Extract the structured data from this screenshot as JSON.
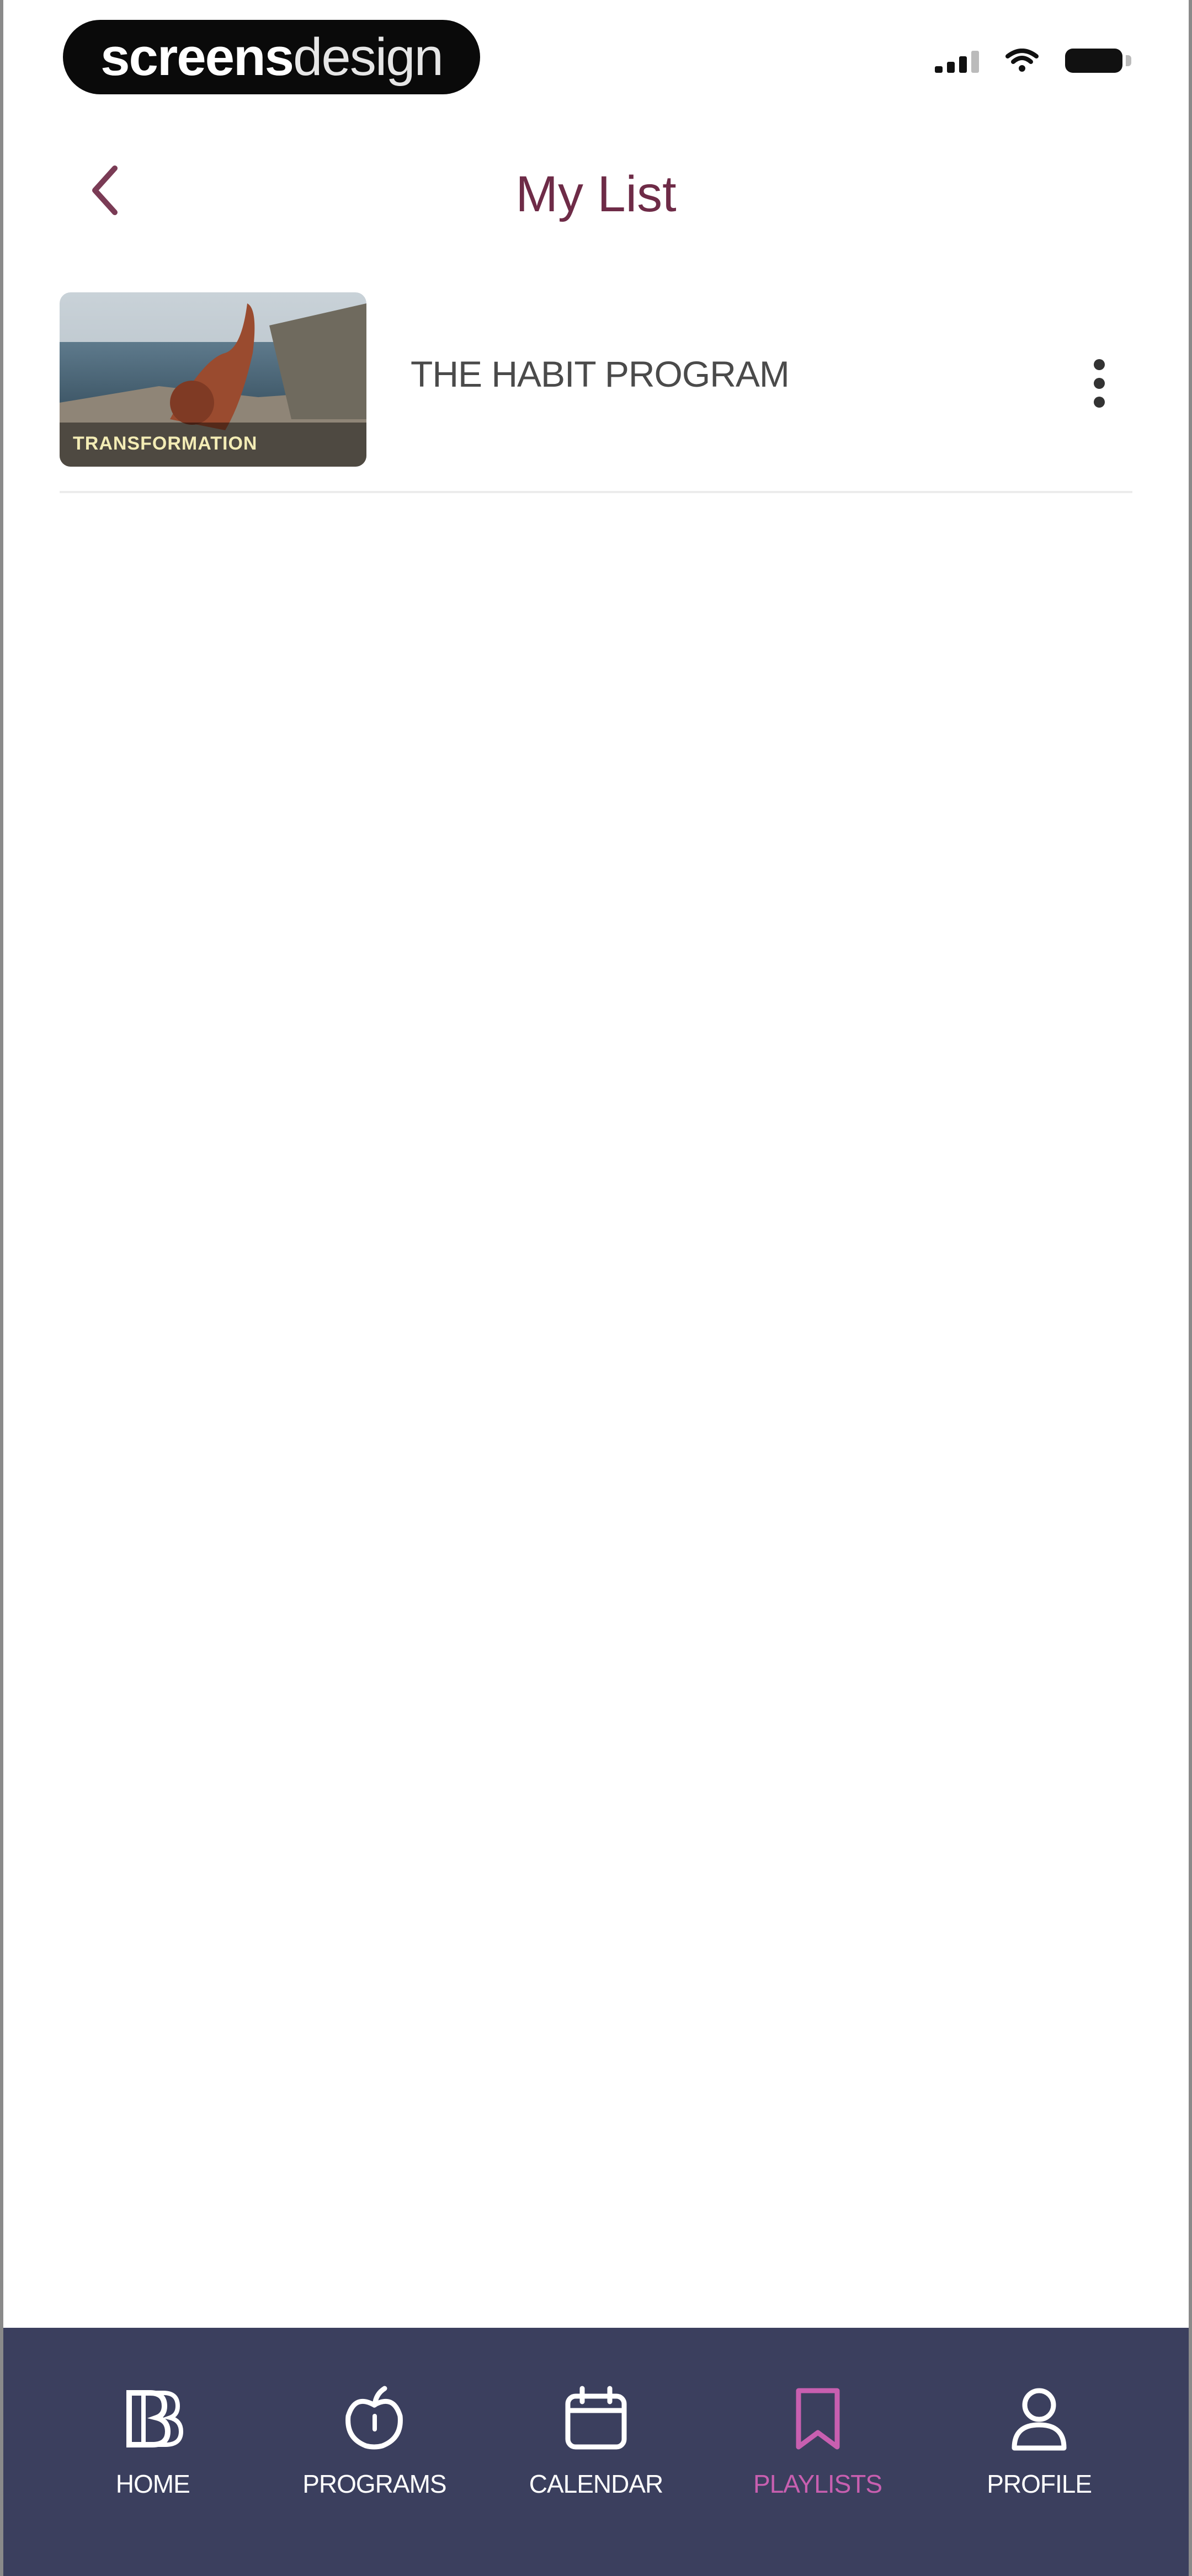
{
  "status_bar": {
    "watermark_bold": "screens",
    "watermark_light": "design"
  },
  "header": {
    "title": "My List"
  },
  "list": {
    "items": [
      {
        "thumbnail_label": "TRANSFORMATION",
        "title": "THE HABIT PROGRAM"
      }
    ]
  },
  "tab_bar": {
    "tabs": [
      {
        "label": "HOME",
        "icon": "logo-icon",
        "active": false
      },
      {
        "label": "PROGRAMS",
        "icon": "apple-icon",
        "active": false
      },
      {
        "label": "CALENDAR",
        "icon": "calendar-icon",
        "active": false
      },
      {
        "label": "PLAYLISTS",
        "icon": "bookmark-icon",
        "active": true
      },
      {
        "label": "PROFILE",
        "icon": "user-icon",
        "active": false
      }
    ]
  },
  "colors": {
    "accent": "#6e2b47",
    "tab_bar_bg": "#3b3f5e",
    "tab_active": "#c85fb0"
  }
}
